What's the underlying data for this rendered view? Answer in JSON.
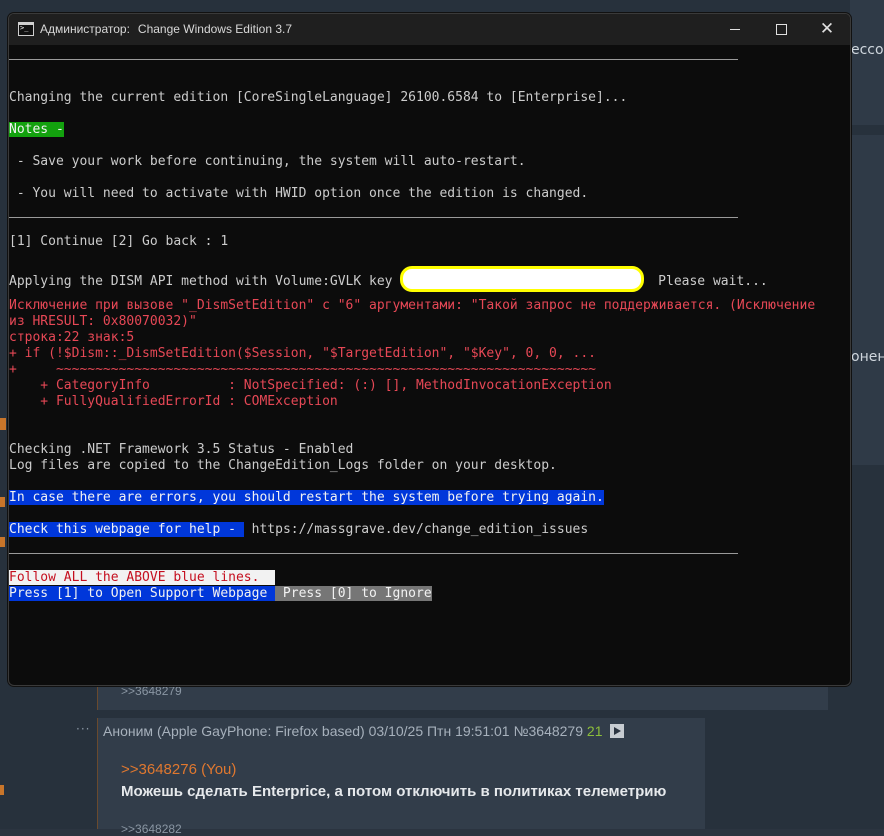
{
  "background": {
    "fragments": {
      "right_top": "ессо",
      "right_mid": "онент"
    },
    "reply_top": ">>3648279",
    "post": {
      "name": "Аноним",
      "os": "(Apple GayPhone: Firefox based)",
      "date": "03/10/25 Птн 19:51:01",
      "num": "№3648279",
      "count": "21",
      "link": ">>3648276 (You)",
      "text": "Можешь сделать Enterprice, а потом отключить в политиках телеметрию",
      "reply_bottom": ">>3648282"
    }
  },
  "window": {
    "title_prefix": "Администратор:",
    "title": "Change Windows Edition 3.7",
    "icon": "console-icon",
    "controls": [
      "minimize-icon",
      "maximize-icon",
      "close-icon"
    ]
  },
  "console": {
    "changing": "Changing the current edition [CoreSingleLanguage] 26100.6584 to [Enterprise]...",
    "notes": "Notes -",
    "note1": " - Save your work before continuing, the system will auto-restart.",
    "note2": " - You will need to activate with HWID option once the edition is changed.",
    "choice": "[1] Continue [2] Go back : 1",
    "applying_prefix": "Applying the DISM API method with Volume:GVLK key",
    "applying_suffix": "Please wait...",
    "err1": "Исключение при вызове \"_DismSetEdition\" с \"6\" аргументами: \"Такой запрос не поддерживается. (Исключение",
    "err2": "из HRESULT: 0x80070032)\"",
    "err3": "строка:22 знак:5",
    "err4": "+ if (!$Dism::_DismSetEdition($Session, \"$TargetEdition\", \"$Key\", 0, 0, ...",
    "err5": "+     ~~~~~~~~~~~~~~~~~~~~~~~~~~~~~~~~~~~~~~~~~~~~~~~~~~~~~~~~~~~~~~~~~~~~~",
    "err6": "    + CategoryInfo          : NotSpecified: (:) [], MethodInvocationException",
    "err7": "    + FullyQualifiedErrorId : COMException",
    "netfx": "Checking .NET Framework 3.5 Status - Enabled",
    "logs": "Log files are copied to the ChangeEdition_Logs folder on your desktop.",
    "restart": "In case there are errors, you should restart the system before trying again.",
    "help_label": "Check this webpage for help - ",
    "help_url": " https://massgrave.dev/change_edition_issues",
    "follow": "Follow ALL the ABOVE blue lines.  ",
    "press1": "Press [1] to Open Support Webpage ",
    "press0": " Press [0] to Ignore"
  },
  "colors": {
    "console_bg": "#0c0c0c",
    "console_text": "#cccccc",
    "green": "#13a10e",
    "blue": "#0037da",
    "red": "#e74856",
    "gray": "#767676",
    "highlight": "#ffff00"
  }
}
